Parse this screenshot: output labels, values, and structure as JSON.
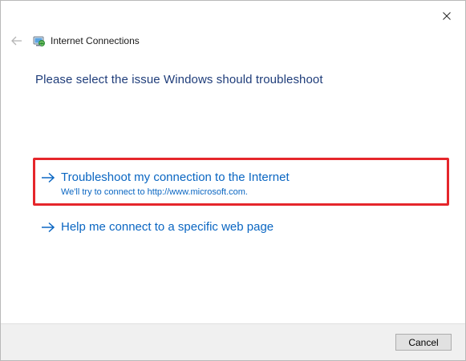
{
  "window": {
    "title": "Internet Connections",
    "icons": {
      "close": "close-icon",
      "back": "back-arrow-icon",
      "app": "internet-connections-icon"
    }
  },
  "main": {
    "instruction": "Please select the issue Windows should troubleshoot",
    "options": [
      {
        "title": "Troubleshoot my connection to the Internet",
        "description": "We'll try to connect to http://www.microsoft.com.",
        "highlighted": true
      },
      {
        "title": "Help me connect to a specific web page",
        "description": "",
        "highlighted": false
      }
    ]
  },
  "footer": {
    "cancel_label": "Cancel"
  },
  "colors": {
    "link": "#0a66c2",
    "instruction": "#1f3d7a",
    "highlight": "#e5262b"
  }
}
